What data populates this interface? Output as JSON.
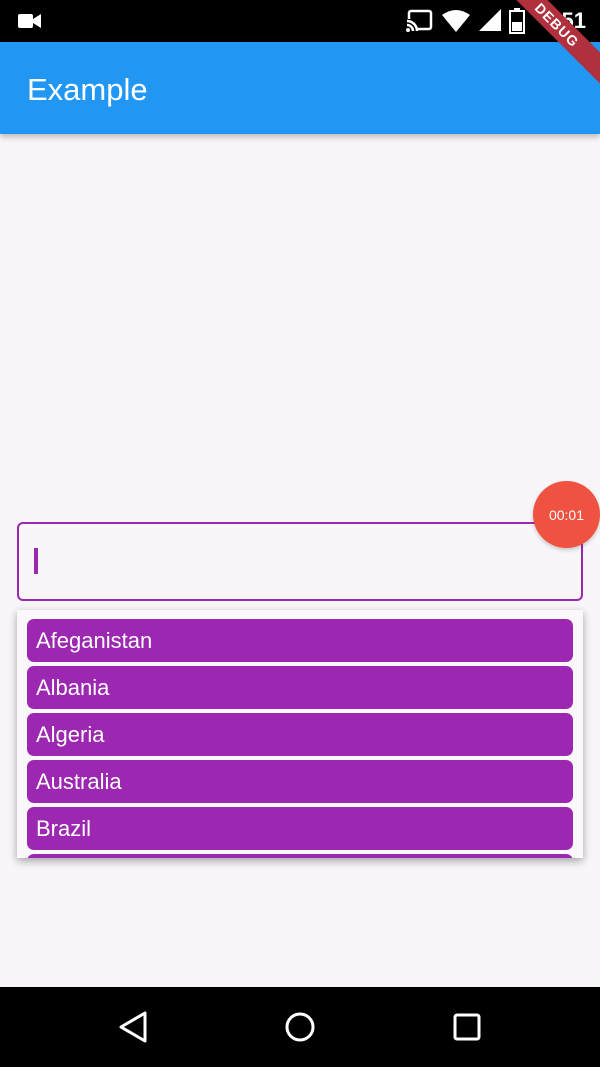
{
  "status_bar": {
    "time": "6:51",
    "icons": [
      "videocam-icon",
      "cast-icon",
      "wifi-icon",
      "signal-icon",
      "battery-icon"
    ]
  },
  "app_bar": {
    "title": "Example"
  },
  "debug_banner": "DEBUG",
  "timer": {
    "label": "00:01",
    "color": "#ef5240"
  },
  "search_field": {
    "value": "",
    "accent_color": "#9c27b0"
  },
  "suggestions": {
    "items": [
      "Afeganistan",
      "Albania",
      "Algeria",
      "Australia",
      "Brazil",
      ""
    ],
    "item_color": "#9c27b0"
  },
  "colors": {
    "app_bar": "#2196f3",
    "background": "#f8f6f9"
  },
  "nav_bar": {
    "icons": [
      "back-icon",
      "home-icon",
      "recents-icon"
    ]
  }
}
